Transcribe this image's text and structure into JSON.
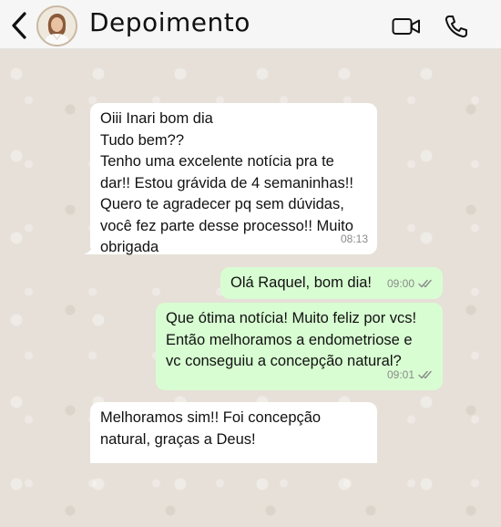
{
  "header": {
    "title": "Depoimento"
  },
  "messages": [
    {
      "direction": "in",
      "text": "Oiii Inari bom dia\nTudo bem??\nTenho uma excelente notícia pra te\ndar!! Estou grávida de 4 semaninhas!!\nQuero te agradecer pq sem dúvidas,\nvocê fez parte desse processo!! Muito\nobrigada",
      "time": "08:13"
    },
    {
      "direction": "out",
      "text": "Olá Raquel, bom dia!",
      "time": "09:00",
      "status": "read"
    },
    {
      "direction": "out",
      "text": "Que ótima notícia! Muito feliz por vcs!\nEntão melhoramos a endometriose e\nvc conseguiu a concepção natural?",
      "time": "09:01",
      "status": "read"
    },
    {
      "direction": "in",
      "text": "Melhoramos sim!! Foi concepção\nnatural, graças a Deus!",
      "time": ""
    }
  ],
  "colors": {
    "incoming_bubble": "#ffffff",
    "outgoing_bubble": "#d8fdd2",
    "read_ticks": "#8a8a8a",
    "header_bg": "#f6f6f6"
  },
  "icons": [
    "back-chevron-icon",
    "contact-avatar",
    "video-call-icon",
    "voice-call-icon",
    "double-check-icon"
  ]
}
